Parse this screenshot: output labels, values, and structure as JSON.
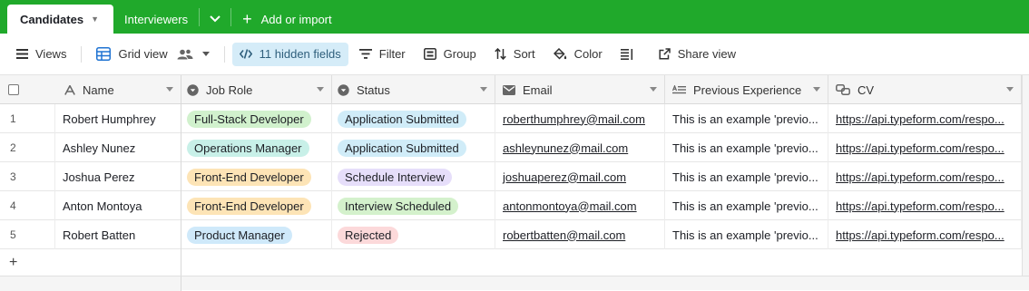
{
  "tabs": {
    "active": "Candidates",
    "other": "Interviewers",
    "add_import": "Add or import"
  },
  "toolbar": {
    "views": "Views",
    "grid_view": "Grid view",
    "hidden_fields": "11 hidden fields",
    "filter": "Filter",
    "group": "Group",
    "sort": "Sort",
    "color": "Color",
    "share_view": "Share view"
  },
  "columns": {
    "name": "Name",
    "job_role": "Job Role",
    "status": "Status",
    "email": "Email",
    "previous_experience": "Previous Experience",
    "cv": "CV"
  },
  "rows": [
    {
      "num": "1",
      "name": "Robert Humphrey",
      "role": "Full-Stack Developer",
      "role_color": "#d1f1cd",
      "status": "Application Submitted",
      "status_color": "#d0ecf8",
      "email": "roberthumphrey@mail.com",
      "prev": "This is an example 'previo...",
      "cv": "https://api.typeform.com/respo..."
    },
    {
      "num": "2",
      "name": "Ashley Nunez",
      "role": "Operations Manager",
      "role_color": "#c8f0e8",
      "status": "Application Submitted",
      "status_color": "#d0ecf8",
      "email": "ashleynunez@mail.com",
      "prev": "This is an example 'previo...",
      "cv": "https://api.typeform.com/respo..."
    },
    {
      "num": "3",
      "name": "Joshua Perez",
      "role": "Front-End Developer",
      "role_color": "#fde4b6",
      "status": "Schedule Interview",
      "status_color": "#e6defa",
      "email": "joshuaperez@mail.com",
      "prev": "This is an example 'previo...",
      "cv": "https://api.typeform.com/respo..."
    },
    {
      "num": "4",
      "name": "Anton Montoya",
      "role": "Front-End Developer",
      "role_color": "#fde4b6",
      "status": "Interview Scheduled",
      "status_color": "#d4f1cc",
      "email": "antonmontoya@mail.com",
      "prev": "This is an example 'previo...",
      "cv": "https://api.typeform.com/respo..."
    },
    {
      "num": "5",
      "name": "Robert Batten",
      "role": "Product Manager",
      "role_color": "#cfe9fa",
      "status": "Rejected",
      "status_color": "#fcd9da",
      "email": "robertbatten@mail.com",
      "prev": "This is an example 'previo...",
      "cv": "https://api.typeform.com/respo..."
    }
  ],
  "add_row_symbol": "+",
  "colors": {
    "tabbar": "#20a92b",
    "hidden_fields_bg": "#d5ecf8"
  },
  "icons": {
    "views": "hamburger-icon",
    "grid_view": "grid-icon",
    "collaborators": "people-icon",
    "hidden_fields": "code-icon",
    "filter": "filter-icon",
    "group": "group-icon",
    "sort": "sort-icon",
    "color": "paint-bucket-icon",
    "row_height": "row-height-icon",
    "share": "share-icon"
  }
}
